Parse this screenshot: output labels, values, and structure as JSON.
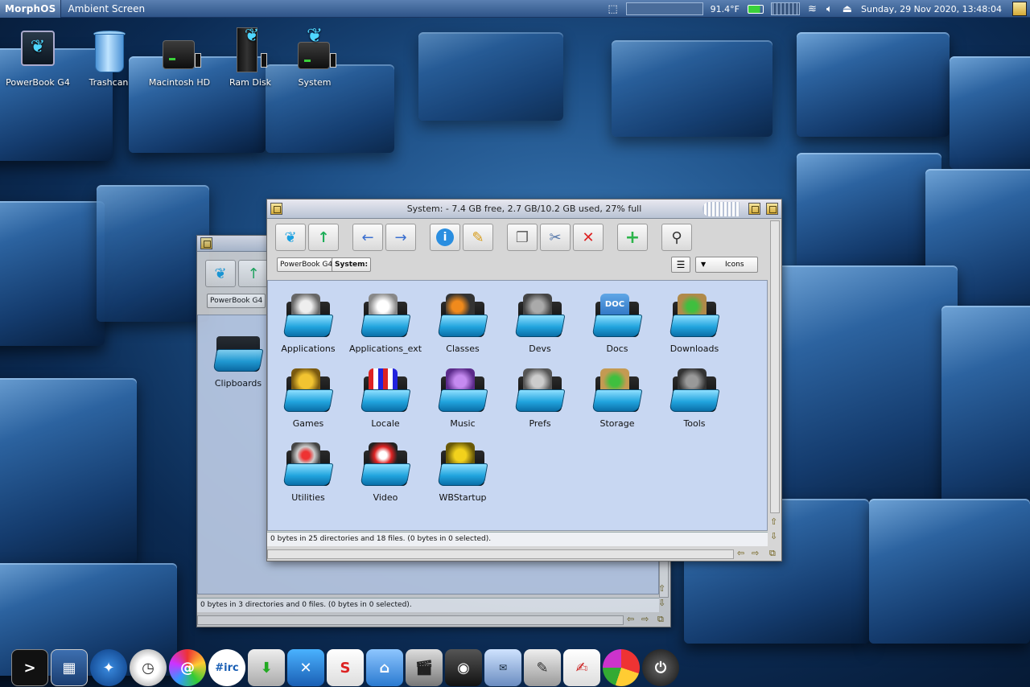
{
  "menubar": {
    "logo": "MorphOS",
    "app_name": "Ambient Screen",
    "temperature": "91.4°F",
    "datetime": "Sunday, 29 Nov 2020, 13:48:04"
  },
  "desktop_icons": [
    {
      "label": "PowerBook G4",
      "icon": "butterfly-drive-icon"
    },
    {
      "label": "Trashcan",
      "icon": "trashcan-icon"
    },
    {
      "label": "Macintosh HD",
      "icon": "hard-drive-icon"
    },
    {
      "label": "Ram Disk",
      "icon": "ram-disk-icon"
    },
    {
      "label": "System",
      "icon": "system-drive-icon"
    }
  ],
  "back_window": {
    "crumb": "PowerBook G4",
    "items": [
      {
        "label": "Clipboards",
        "icon": "clipboards-folder-icon"
      }
    ],
    "status": "0 bytes in 3 directories and 0 files. (0 bytes in 0 selected)."
  },
  "main_window": {
    "title": "System: - 7.4 GB free, 2.7 GB/10.2 GB used, 27% full",
    "crumbs": [
      "PowerBook G4",
      "System:"
    ],
    "view_mode": "Icons",
    "toolbar": [
      {
        "name": "ambient-button",
        "icon": "butterfly-icon"
      },
      {
        "name": "parent-button",
        "icon": "arrow-up-icon"
      },
      {
        "name": "back-button",
        "icon": "arrow-left-icon"
      },
      {
        "name": "forward-button",
        "icon": "arrow-right-icon"
      },
      {
        "name": "info-button",
        "icon": "info-icon"
      },
      {
        "name": "rename-button",
        "icon": "pencil-icon"
      },
      {
        "name": "copy-button",
        "icon": "copy-icon"
      },
      {
        "name": "cut-button",
        "icon": "scissors-icon"
      },
      {
        "name": "delete-button",
        "icon": "delete-x-icon"
      },
      {
        "name": "new-button",
        "icon": "plus-icon"
      },
      {
        "name": "search-button",
        "icon": "magnifier-icon"
      }
    ],
    "items": [
      {
        "label": "Applications"
      },
      {
        "label": "Applications_ext"
      },
      {
        "label": "Classes"
      },
      {
        "label": "Devs"
      },
      {
        "label": "Docs"
      },
      {
        "label": "Downloads"
      },
      {
        "label": "Games"
      },
      {
        "label": "Locale"
      },
      {
        "label": "Music"
      },
      {
        "label": "Prefs"
      },
      {
        "label": "Storage"
      },
      {
        "label": "Tools"
      },
      {
        "label": "Utilities"
      },
      {
        "label": "Video"
      },
      {
        "label": "WBStartup"
      }
    ],
    "status": "0 bytes in 25 directories and 18 files. (0 bytes in 0 selected)."
  },
  "dock": [
    {
      "name": "shell",
      "text": ">"
    },
    {
      "name": "ambient"
    },
    {
      "name": "browser"
    },
    {
      "name": "clock"
    },
    {
      "name": "mail"
    },
    {
      "name": "irc",
      "text": "#irc"
    },
    {
      "name": "downloads"
    },
    {
      "name": "grab"
    },
    {
      "name": "audio"
    },
    {
      "name": "store"
    },
    {
      "name": "movie"
    },
    {
      "name": "radio"
    },
    {
      "name": "eve"
    },
    {
      "name": "paint"
    },
    {
      "name": "notes"
    },
    {
      "name": "charts"
    },
    {
      "name": "shutdown"
    }
  ]
}
